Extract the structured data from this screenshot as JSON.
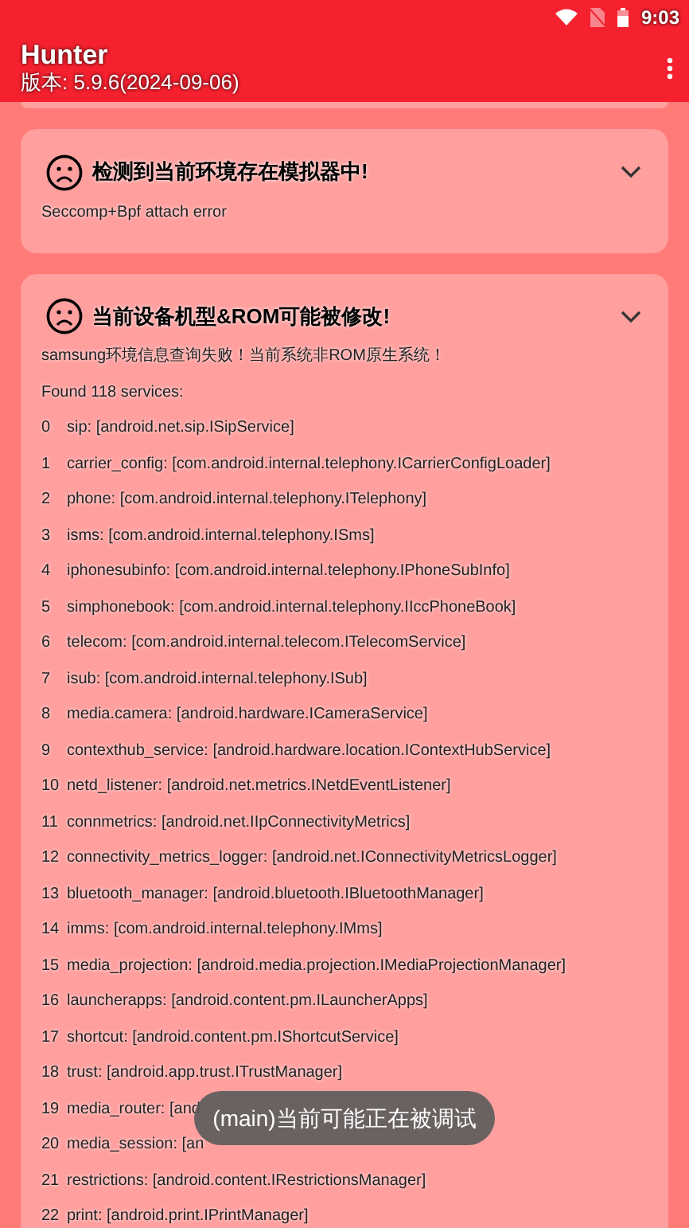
{
  "status_bar": {
    "time": "9:03"
  },
  "app_bar": {
    "title": "Hunter",
    "subtitle": "版本: 5.9.6(2024-09-06)"
  },
  "cards": [
    {
      "title": "检测到当前环境存在模拟器中!",
      "expanded": true,
      "lines": [
        {
          "kind": "text",
          "text": "Seccomp+Bpf attach error"
        }
      ]
    },
    {
      "title": "当前设备机型&ROM可能被修改!",
      "expanded": true,
      "lines": [
        {
          "kind": "text",
          "text": "samsung环境信息查询失败！当前系统非ROM原生系统！"
        },
        {
          "kind": "text",
          "text": "Found 118 services:"
        },
        {
          "kind": "service",
          "index": "0",
          "text": "sip: [android.net.sip.ISipService]"
        },
        {
          "kind": "service",
          "index": "1",
          "text": "carrier_config: [com.android.internal.telephony.ICarrierConfigLoader]"
        },
        {
          "kind": "service",
          "index": "2",
          "text": "phone: [com.android.internal.telephony.ITelephony]"
        },
        {
          "kind": "service",
          "index": "3",
          "text": "isms: [com.android.internal.telephony.ISms]"
        },
        {
          "kind": "service",
          "index": "4",
          "text": "iphonesubinfo: [com.android.internal.telephony.IPhoneSubInfo]"
        },
        {
          "kind": "service",
          "index": "5",
          "text": "simphonebook: [com.android.internal.telephony.IIccPhoneBook]"
        },
        {
          "kind": "service",
          "index": "6",
          "text": "telecom: [com.android.internal.telecom.ITelecomService]"
        },
        {
          "kind": "service",
          "index": "7",
          "text": "isub: [com.android.internal.telephony.ISub]"
        },
        {
          "kind": "service",
          "index": "8",
          "text": "media.camera: [android.hardware.ICameraService]"
        },
        {
          "kind": "service",
          "index": "9",
          "text": "contexthub_service: [android.hardware.location.IContextHubService]"
        },
        {
          "kind": "service",
          "index": "10",
          "text": "netd_listener: [android.net.metrics.INetdEventListener]"
        },
        {
          "kind": "service",
          "index": "11",
          "text": "connmetrics: [android.net.IIpConnectivityMetrics]"
        },
        {
          "kind": "service",
          "index": "12",
          "text": "connectivity_metrics_logger: [android.net.IConnectivityMetricsLogger]"
        },
        {
          "kind": "service",
          "index": "13",
          "text": "bluetooth_manager: [android.bluetooth.IBluetoothManager]"
        },
        {
          "kind": "service",
          "index": "14",
          "text": "imms: [com.android.internal.telephony.IMms]"
        },
        {
          "kind": "service",
          "index": "15",
          "text": "media_projection: [android.media.projection.IMediaProjectionManager]"
        },
        {
          "kind": "service",
          "index": "16",
          "text": "launcherapps: [android.content.pm.ILauncherApps]"
        },
        {
          "kind": "service",
          "index": "17",
          "text": "shortcut: [android.content.pm.IShortcutService]"
        },
        {
          "kind": "service",
          "index": "18",
          "text": "trust: [android.app.trust.ITrustManager]"
        },
        {
          "kind": "service",
          "index": "19",
          "text": "media_router: [and"
        },
        {
          "kind": "service",
          "index": "20",
          "text": "media_session: [an"
        },
        {
          "kind": "service",
          "index": "21",
          "text": "restrictions: [android.content.IRestrictionsManager]"
        },
        {
          "kind": "service",
          "index": "22",
          "text": "print: [android.print.IPrintManager]"
        }
      ]
    }
  ],
  "toast": {
    "text": "(main)当前可能正在被调试"
  }
}
